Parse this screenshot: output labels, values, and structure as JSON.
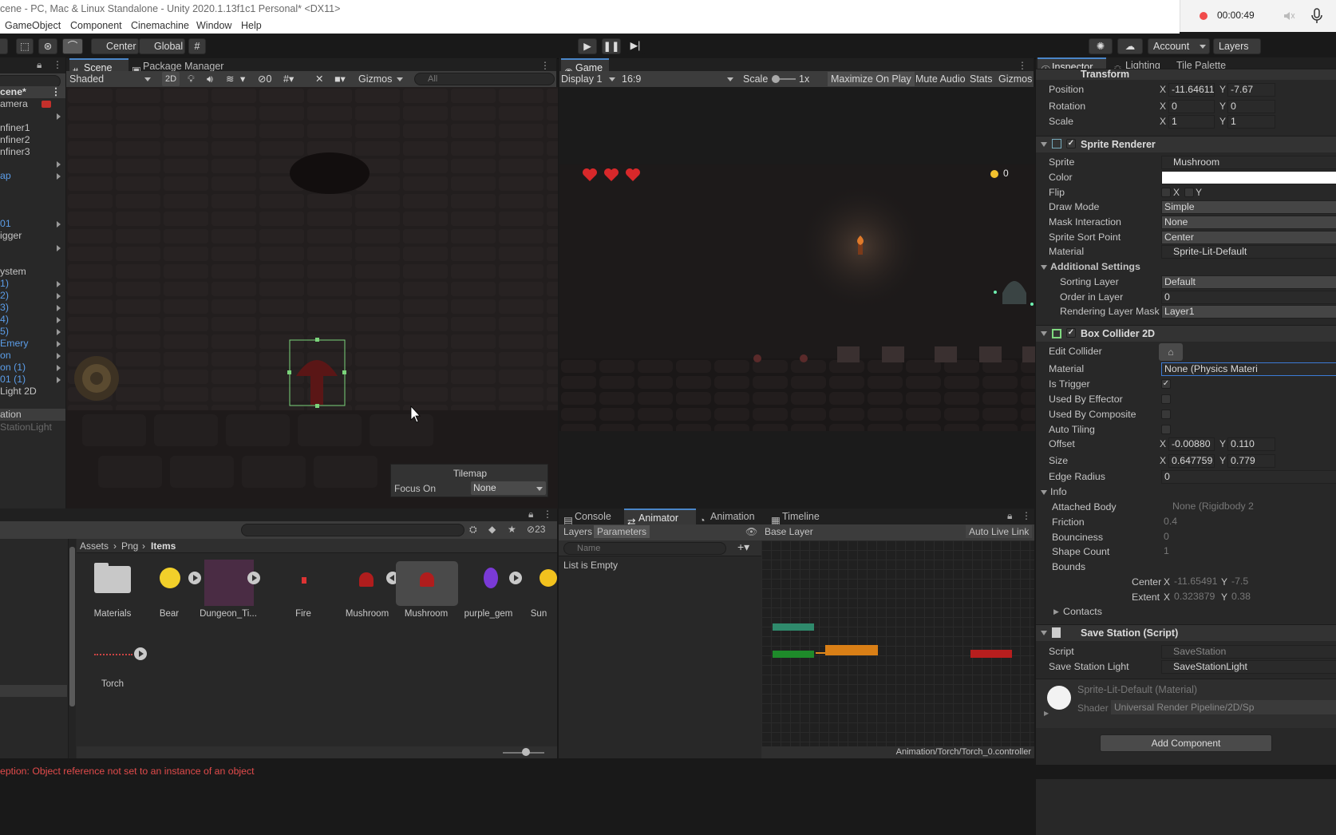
{
  "window": {
    "title": "cene - PC, Mac & Linux Standalone - Unity 2020.1.13f1c1 Personal* <DX11>",
    "recording_time": "00:00:49"
  },
  "menu": [
    "GameObject",
    "Component",
    "Cinemachine",
    "Window",
    "Help"
  ],
  "toolbar": {
    "pivot": "Center",
    "space": "Global",
    "account": "Account",
    "layers": "Layers"
  },
  "hierarchy": {
    "search": "",
    "scene": "cene*",
    "items": [
      {
        "label": "amera",
        "color": "white"
      },
      {
        "label": "",
        "color": "white"
      },
      {
        "label": "nfiner1",
        "color": "white"
      },
      {
        "label": "nfiner2",
        "color": "white"
      },
      {
        "label": "nfiner3",
        "color": "white"
      },
      {
        "label": "",
        "color": "white"
      },
      {
        "label": "ap",
        "color": "blue"
      },
      {
        "label": "",
        "color": "white"
      },
      {
        "label": "01",
        "color": "blue"
      },
      {
        "label": "igger",
        "color": "white"
      },
      {
        "label": "",
        "color": "white"
      },
      {
        "label": "ystem",
        "color": "white"
      },
      {
        "label": "1)",
        "color": "blue"
      },
      {
        "label": "2)",
        "color": "blue"
      },
      {
        "label": "3)",
        "color": "blue"
      },
      {
        "label": "4)",
        "color": "blue"
      },
      {
        "label": "5)",
        "color": "blue"
      },
      {
        "label": "Emery",
        "color": "blue"
      },
      {
        "label": "on",
        "color": "blue"
      },
      {
        "label": "on (1)",
        "color": "blue"
      },
      {
        "label": "01 (1)",
        "color": "blue"
      },
      {
        "label": "Light 2D",
        "color": "white"
      },
      {
        "label": "ation",
        "color": "white"
      },
      {
        "label": "StationLight",
        "color": "dim"
      }
    ]
  },
  "scene": {
    "tabs": [
      "Scene",
      "Package Manager"
    ],
    "shading": "Shaded",
    "mode2d": "2D",
    "hidden_count": "0",
    "gizmos": "Gizmos",
    "search_placeholder": "All",
    "overlay": {
      "title": "Tilemap",
      "focus_label": "Focus On",
      "focus_value": "None"
    }
  },
  "game": {
    "tab": "Game",
    "display": "Display 1",
    "aspect": "16:9",
    "scale_label": "Scale",
    "scale_value": "1x",
    "buttons": [
      "Maximize On Play",
      "Mute Audio",
      "Stats",
      "Gizmos"
    ],
    "coins": "0"
  },
  "inspector": {
    "tabs": [
      "Inspector",
      "Lighting",
      "Tile Palette"
    ],
    "transform": {
      "title": "Transform",
      "position": {
        "label": "Position",
        "x": "-11.64611",
        "y": "-7.67"
      },
      "rotation": {
        "label": "Rotation",
        "x": "0",
        "y": "0"
      },
      "scale": {
        "label": "Scale",
        "x": "1",
        "y": "1"
      }
    },
    "sprite_renderer": {
      "title": "Sprite Renderer",
      "sprite_label": "Sprite",
      "sprite": "Mushroom",
      "color_label": "Color",
      "flip_label": "Flip",
      "flip_x": "X",
      "flip_y": "Y",
      "draw_mode_label": "Draw Mode",
      "draw_mode": "Simple",
      "mask_label": "Mask Interaction",
      "mask": "None",
      "sort_point_label": "Sprite Sort Point",
      "sort_point": "Center",
      "material_label": "Material",
      "material": "Sprite-Lit-Default",
      "additional": "Additional Settings",
      "sorting_layer_label": "Sorting Layer",
      "sorting_layer": "Default",
      "order_label": "Order in Layer",
      "order": "0",
      "rlm_label": "Rendering Layer Mask",
      "rlm": "Layer1"
    },
    "box_collider": {
      "title": "Box Collider 2D",
      "edit_label": "Edit Collider",
      "material_label": "Material",
      "material": "None (Physics Materi",
      "trigger_label": "Is Trigger",
      "effector_label": "Used By Effector",
      "composite_label": "Used By Composite",
      "tiling_label": "Auto Tiling",
      "offset_label": "Offset",
      "offset_x": "-0.00880",
      "offset_y": "0.110",
      "size_label": "Size",
      "size_x": "0.647759…",
      "size_y": "0.779",
      "edge_label": "Edge Radius",
      "edge": "0",
      "info_label": "Info",
      "attached_label": "Attached Body",
      "attached": "None (Rigidbody 2",
      "friction_label": "Friction",
      "friction": "0.4",
      "bounciness_label": "Bounciness",
      "bounciness": "0",
      "shape_label": "Shape Count",
      "shape": "1",
      "bounds_label": "Bounds",
      "center_label": "Center",
      "center_x": "-11.65491",
      "center_y": "-7.5",
      "extent_label": "Extent",
      "extent_x": "0.323879",
      "extent_y": "0.38",
      "contacts_label": "Contacts"
    },
    "save_station": {
      "title": "Save Station (Script)",
      "script_label": "Script",
      "script": "SaveStation",
      "light_label": "Save Station Light",
      "light": "SaveStationLight"
    },
    "material_preview": {
      "name": "Sprite-Lit-Default (Material)",
      "shader_label": "Shader",
      "shader": "Universal Render Pipeline/2D/Sp"
    },
    "add_component": "Add Component"
  },
  "project": {
    "search": "",
    "hidden_count": "23",
    "breadcrumb": [
      "Assets",
      "Png",
      "Items"
    ],
    "assets": [
      "Materials",
      "Bear",
      "Dungeon_Ti...",
      "Fire",
      "Mushroom",
      "Mushroom",
      "purple_gem",
      "Sun",
      "Torch"
    ]
  },
  "animator": {
    "tabs": [
      "Console",
      "Animator",
      "Animation",
      "Timeline"
    ],
    "left_tabs": [
      "Layers",
      "Parameters"
    ],
    "search_placeholder": "Name",
    "empty": "List is Empty",
    "base_layer": "Base Layer",
    "auto_live_link": "Auto Live Link",
    "path": "Animation/Torch/Torch_0.controller"
  },
  "status": {
    "message": "eption: Object reference not set to an instance of an object"
  }
}
